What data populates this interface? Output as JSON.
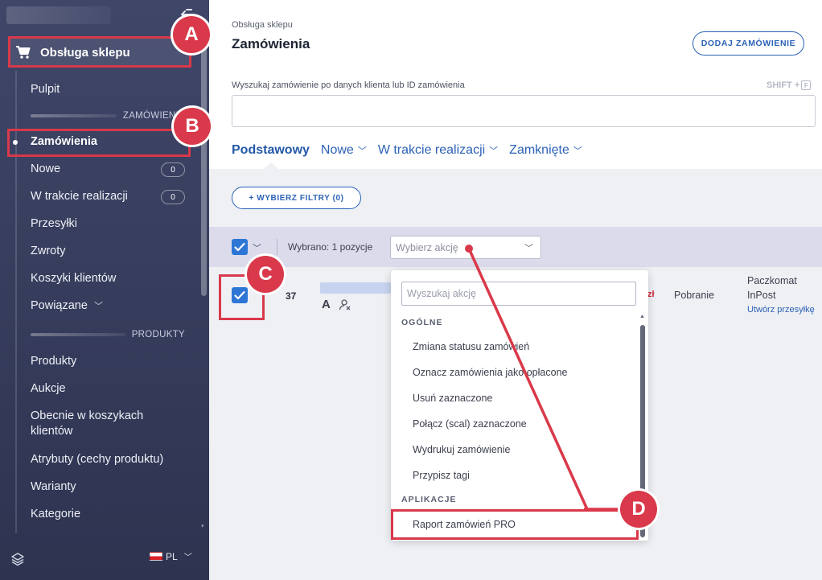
{
  "sidebar": {
    "shop_label": "Obsługa sklepu",
    "items": {
      "pulpit": "Pulpit",
      "zamowienia": "Zamówienia",
      "nowe": "Nowe",
      "w_trakcie": "W trakcie realizacji",
      "przesylki": "Przesyłki",
      "zwroty": "Zwroty",
      "koszyki": "Koszyki klientów",
      "powiazane": "Powiązane",
      "produkty": "Produkty",
      "aukcje": "Aukcje",
      "obecnie_line1": "Obecnie w koszykach",
      "obecnie_line2": "klientów",
      "atrybuty": "Atrybuty (cechy produktu)",
      "warianty": "Warianty",
      "kategorie": "Kategorie"
    },
    "badges": {
      "nowe": "0",
      "w_trakcie": "0"
    },
    "sections": {
      "orders": "ZAMÓWIENIA",
      "products": "PRODUKTY"
    },
    "language": "PL"
  },
  "header": {
    "breadcrumb": "Obsługa sklepu",
    "title": "Zamówienia",
    "add_order_button": "DODAJ ZAMÓWIENIE"
  },
  "search": {
    "label": "Wyszukaj zamówienie po danych klienta lub ID zamówienia",
    "shortcut": "SHIFT +",
    "shortcut_key": "F",
    "value": ""
  },
  "tabs": {
    "basic": "Podstawowy",
    "new": "Nowe",
    "in_progress": "W trakcie realizacji",
    "closed": "Zamknięte"
  },
  "filters_button": "+ WYBIERZ FILTRY (0)",
  "bulk": {
    "selected_text": "Wybrano: 1 pozycje",
    "action_placeholder": "Wybierz akcję"
  },
  "order": {
    "number": "37",
    "avatar_letter": "A",
    "price_fragment": "zł",
    "payment": "Pobranie",
    "shipping_line1": "Paczkomat",
    "shipping_line2": "InPost",
    "create_shipment_link": "Utwórz przesyłkę"
  },
  "action_dropdown": {
    "search_placeholder": "Wyszukaj akcję",
    "groups": {
      "general": "OGÓLNE",
      "apps": "APLIKACJE"
    },
    "general_items": [
      "Zmiana statusu zamówień",
      "Oznacz zamówienia jako opłacone",
      "Usuń zaznaczone",
      "Połącz (scal) zaznaczone",
      "Wydrukuj zamówienie",
      "Przypisz tagi"
    ],
    "app_items": [
      "Raport zamówień PRO"
    ]
  },
  "annotations": {
    "a": "A",
    "b": "B",
    "c": "C",
    "d": "D",
    "color": "#d9394a"
  },
  "colors": {
    "sidebar_bg": "#3a405f",
    "accent_blue": "#2c62b6",
    "checkbox_blue": "#2d76d6",
    "bulk_bar_bg": "#dcdbec"
  }
}
